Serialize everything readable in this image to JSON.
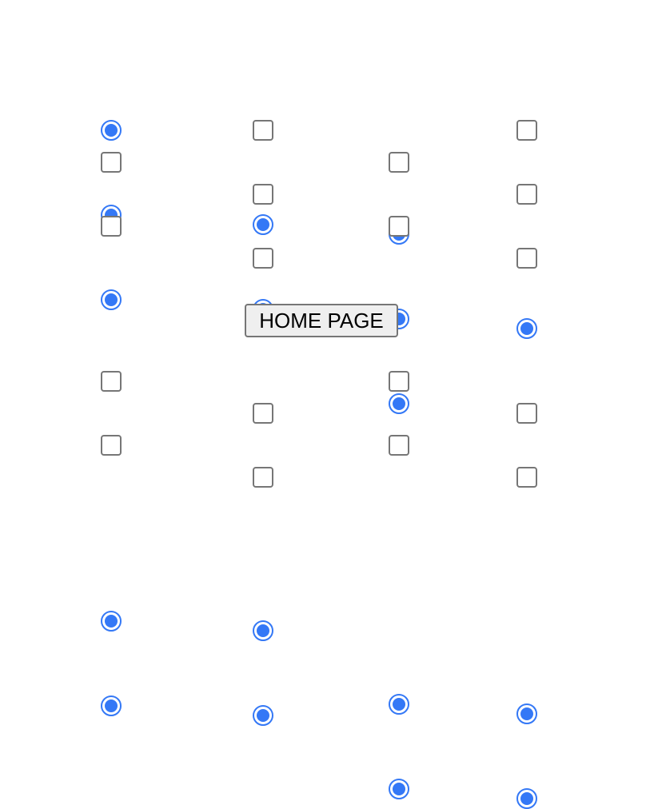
{
  "home_button": {
    "label": "HOME PAGE"
  },
  "accent_color": "#3478f6",
  "top_grid": {
    "columns": [
      [
        "radio",
        "checkbox",
        "radio",
        "checkbox",
        "radio"
      ],
      [
        "checkbox",
        "radio",
        "checkbox",
        "radio",
        "checkbox"
      ],
      [
        "radio",
        "checkbox",
        "radio",
        "checkbox",
        "radio"
      ],
      [
        "checkbox",
        "radio",
        "checkbox",
        "radio",
        "checkbox"
      ]
    ]
  },
  "bottom_grid": {
    "columns": [
      [
        "checkbox",
        "radio",
        "checkbox",
        "radio"
      ],
      [
        "radio",
        "checkbox",
        "radio",
        "checkbox"
      ],
      [
        "checkbox",
        "radio",
        "checkbox",
        "radio"
      ],
      [
        "radio",
        "checkbox",
        "radio",
        "checkbox"
      ]
    ]
  }
}
